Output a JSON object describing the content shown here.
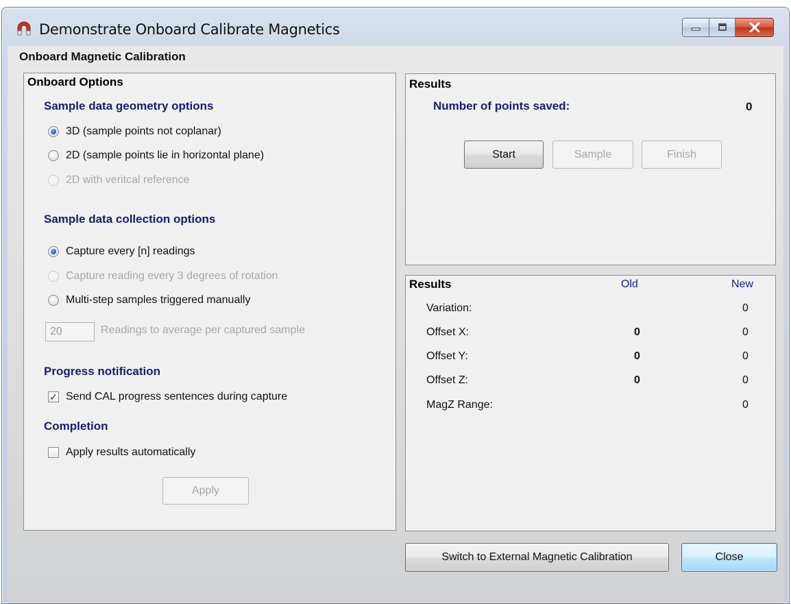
{
  "window": {
    "title": "Demonstrate Onboard Calibrate Magnetics",
    "header": "Onboard Magnetic Calibration"
  },
  "options": {
    "group_title": "Onboard Options",
    "geometry": {
      "title": "Sample data geometry options",
      "items": [
        {
          "label": "3D  (sample points not coplanar)",
          "checked": true,
          "enabled": true
        },
        {
          "label": "2D  (sample points lie in horizontal plane)",
          "checked": false,
          "enabled": true
        },
        {
          "label": "2D with veritcal reference",
          "checked": false,
          "enabled": false
        }
      ]
    },
    "collection": {
      "title": "Sample data collection options",
      "items": [
        {
          "label": "Capture every [n] readings",
          "checked": true,
          "enabled": true
        },
        {
          "label": "Capture reading every 3 degrees of rotation",
          "checked": false,
          "enabled": false
        },
        {
          "label": "Multi-step samples triggered manually",
          "checked": false,
          "enabled": true
        }
      ],
      "readings_value": "20",
      "readings_label": "Readings to average per captured sample"
    },
    "progress": {
      "title": "Progress notification",
      "checkbox_label": "Send CAL progress sentences during capture",
      "checked": true
    },
    "completion": {
      "title": "Completion",
      "checkbox_label": "Apply results automatically",
      "checked": false,
      "apply_label": "Apply"
    }
  },
  "results_top": {
    "title": "Results",
    "points_label": "Number of points saved:",
    "points_value": "0",
    "start_label": "Start",
    "sample_label": "Sample",
    "finish_label": "Finish"
  },
  "results_table": {
    "title": "Results",
    "col_old": "Old",
    "col_new": "New",
    "rows": [
      {
        "label": "Variation:",
        "old": "",
        "new": "0"
      },
      {
        "label": "Offset X:",
        "old": "0",
        "new": "0"
      },
      {
        "label": "Offset Y:",
        "old": "0",
        "new": "0"
      },
      {
        "label": "Offset Z:",
        "old": "0",
        "new": "0"
      },
      {
        "label": "MagZ Range:",
        "old": "",
        "new": "0"
      }
    ]
  },
  "footer": {
    "switch_label": "Switch to External Magnetic Calibration",
    "close_label": "Close"
  }
}
